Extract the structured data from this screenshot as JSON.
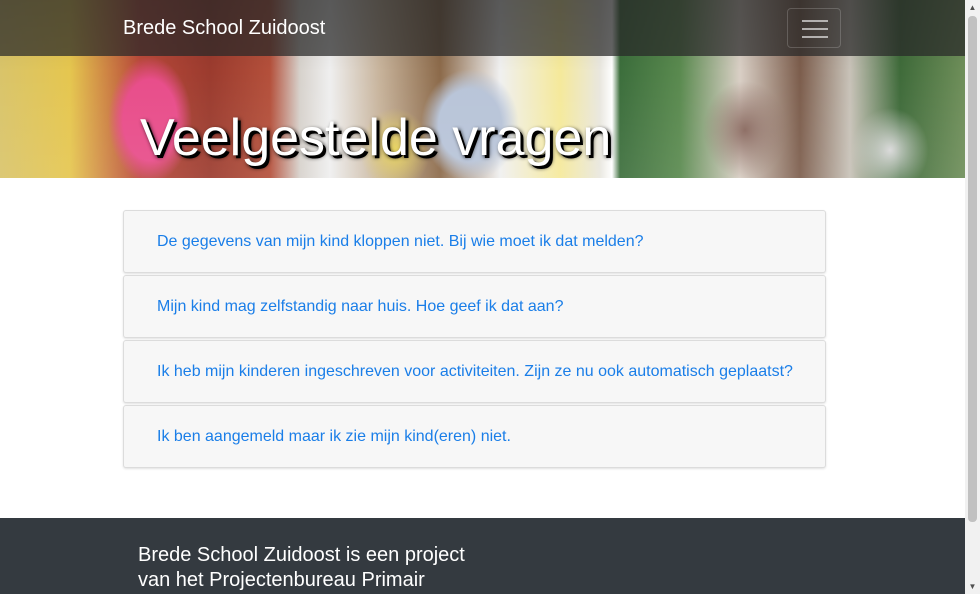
{
  "navbar": {
    "brand": "Brede School Zuidoost",
    "menu_toggle_icon": "hamburger-icon"
  },
  "hero": {
    "title": "Veelgestelde vragen"
  },
  "faq": {
    "items": [
      {
        "question": "De gegevens van mijn kind kloppen niet. Bij wie moet ik dat melden?"
      },
      {
        "question": "Mijn kind mag zelfstandig naar huis. Hoe geef ik dat aan?"
      },
      {
        "question": "Ik heb mijn kinderen ingeschreven voor activiteiten. Zijn ze nu ook automatisch geplaatst?"
      },
      {
        "question": "Ik ben aangemeld maar ik zie mijn kind(eren) niet."
      }
    ]
  },
  "footer": {
    "line1": "Brede School Zuidoost is een project",
    "line2": "van het Projectenbureau Primair"
  },
  "colors": {
    "navbar_bg": "#282828",
    "link": "#1a7ee8",
    "footer_bg": "#343a40",
    "card_bg": "#f7f7f7"
  }
}
